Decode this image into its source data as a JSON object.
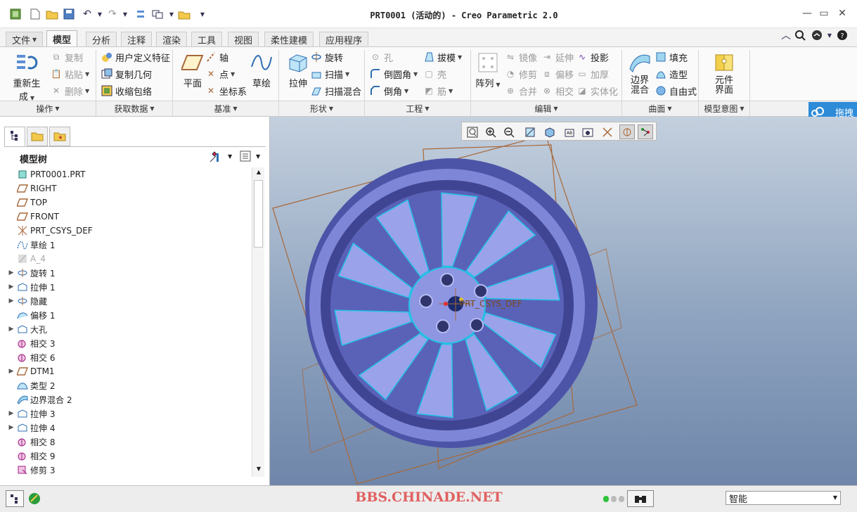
{
  "window": {
    "title": "PRT0001 (活动的) - Creo Parametric 2.0"
  },
  "tabs": [
    "文件",
    "模型",
    "分析",
    "注释",
    "渲染",
    "工具",
    "视图",
    "柔性建模",
    "应用程序"
  ],
  "ribbon": {
    "operations": {
      "regenerate": "重新生成",
      "copy": "复制",
      "paste": "粘贴",
      "delete": "删除",
      "group": "操作"
    },
    "get_data": {
      "udf": "用户定义特征",
      "copy_geom": "复制几何",
      "shrinkwrap": "收缩包络",
      "group": "获取数据"
    },
    "datum": {
      "plane": "平面",
      "axis": "轴",
      "point": "点",
      "csys": "坐标系",
      "sketch": "草绘",
      "group": "基准"
    },
    "shapes": {
      "extrude": "拉伸",
      "revolve": "旋转",
      "sweep": "扫描",
      "swept_blend": "扫描混合",
      "group": "形状"
    },
    "engineering": {
      "hole": "孔",
      "draft": "拔模",
      "round": "倒圆角",
      "shell": "壳",
      "chamfer": "倒角",
      "rib": "筋",
      "group": "工程"
    },
    "editing": {
      "pattern": "阵列",
      "mirror": "镜像",
      "extend": "延伸",
      "project": "投影",
      "trim": "修剪",
      "offset": "偏移",
      "thicken": "加厚",
      "merge": "合并",
      "intersect": "相交",
      "solidify": "实体化",
      "group": "编辑"
    },
    "surfaces": {
      "boundary_blend": "边界混合",
      "fill": "填充",
      "style": "造型",
      "freestyle": "自由式",
      "group": "曲面"
    },
    "model_intent": {
      "component_interface": "元件界面",
      "group": "模型意图"
    }
  },
  "model_tree": {
    "title": "模型树",
    "items": [
      {
        "label": "PRT0001.PRT",
        "icon": "part-icon",
        "expand": false,
        "disabled": false
      },
      {
        "label": "RIGHT",
        "icon": "datum-plane-icon",
        "expand": false,
        "disabled": false
      },
      {
        "label": "TOP",
        "icon": "datum-plane-icon",
        "expand": false,
        "disabled": false
      },
      {
        "label": "FRONT",
        "icon": "datum-plane-icon",
        "expand": false,
        "disabled": false
      },
      {
        "label": "PRT_CSYS_DEF",
        "icon": "csys-icon",
        "expand": false,
        "disabled": false
      },
      {
        "label": "草绘 1",
        "icon": "sketch-icon",
        "expand": false,
        "disabled": false
      },
      {
        "label": "A_4",
        "icon": "axis-icon",
        "expand": false,
        "disabled": true
      },
      {
        "label": "旋转 1",
        "icon": "revolve-icon",
        "expand": true,
        "disabled": false
      },
      {
        "label": "拉伸 1",
        "icon": "extrude-icon",
        "expand": true,
        "disabled": false
      },
      {
        "label": "隐藏",
        "icon": "revolve-icon",
        "expand": true,
        "disabled": false
      },
      {
        "label": "偏移 1",
        "icon": "offset-icon",
        "expand": false,
        "disabled": false
      },
      {
        "label": "大孔",
        "icon": "extrude-icon",
        "expand": true,
        "disabled": false
      },
      {
        "label": "相交 3",
        "icon": "intersect-icon",
        "expand": false,
        "disabled": false
      },
      {
        "label": "相交 6",
        "icon": "intersect-icon",
        "expand": false,
        "disabled": false
      },
      {
        "label": "DTM1",
        "icon": "datum-plane-icon",
        "expand": true,
        "disabled": false
      },
      {
        "label": "类型 2",
        "icon": "style-icon",
        "expand": false,
        "disabled": false
      },
      {
        "label": "边界混合 2",
        "icon": "boundary-icon",
        "expand": false,
        "disabled": false
      },
      {
        "label": "拉伸 3",
        "icon": "extrude-icon",
        "expand": true,
        "disabled": false
      },
      {
        "label": "拉伸 4",
        "icon": "extrude-icon",
        "expand": true,
        "disabled": false
      },
      {
        "label": "相交 8",
        "icon": "intersect-icon",
        "expand": false,
        "disabled": false
      },
      {
        "label": "相交 9",
        "icon": "intersect-icon",
        "expand": false,
        "disabled": false
      },
      {
        "label": "修剪 3",
        "icon": "trim-icon",
        "expand": false,
        "disabled": false
      }
    ]
  },
  "viewport": {
    "csys_label": "PRT_CSYS_DEF"
  },
  "status": {
    "watermark": "BBS.CHINADE.NET",
    "filter_value": "智能"
  },
  "drag_badge": "拖拽",
  "colors": {
    "accent": "#2e8bd8",
    "rim": "#7e86d8",
    "edge": "#23c3e6",
    "datum": "#a8683a"
  }
}
